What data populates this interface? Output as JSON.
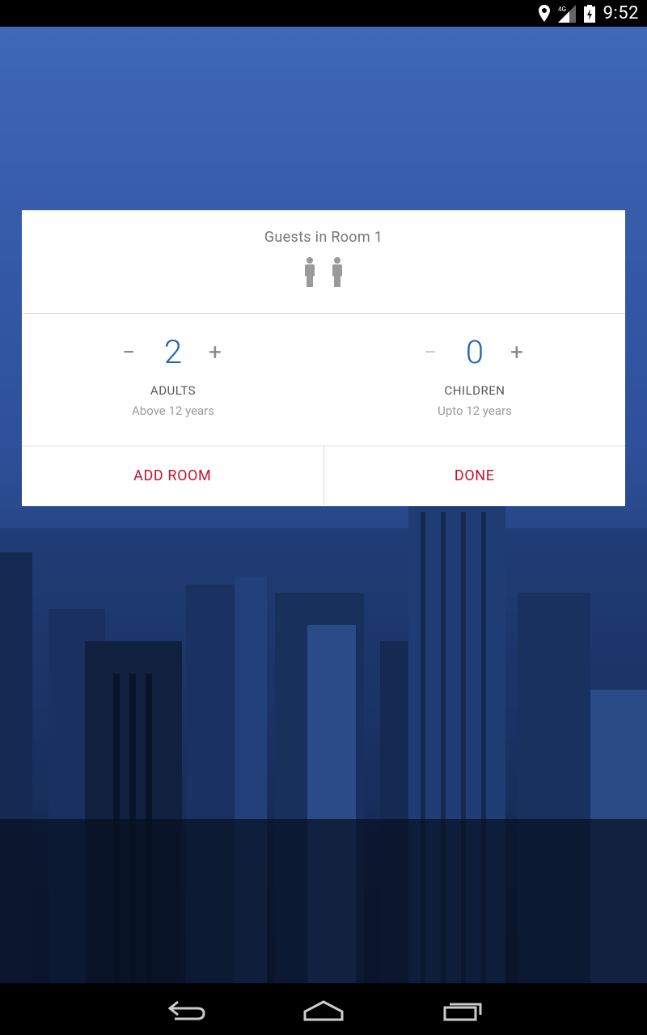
{
  "status_bar": {
    "time": "9:52",
    "network": "4G"
  },
  "dialog": {
    "title": "Guests in Room 1",
    "guest_count_icons": 2,
    "adults": {
      "value": "2",
      "label": "ADULTS",
      "sub": "Above 12 years",
      "minus": "−",
      "plus": "+"
    },
    "children": {
      "value": "0",
      "label": "CHILDREN",
      "sub": "Upto 12 years",
      "minus": "−",
      "plus": "+"
    },
    "actions": {
      "add_room": "ADD ROOM",
      "done": "DONE"
    }
  },
  "colors": {
    "accent_blue": "#1f63b5",
    "action_red": "#c8102e"
  }
}
